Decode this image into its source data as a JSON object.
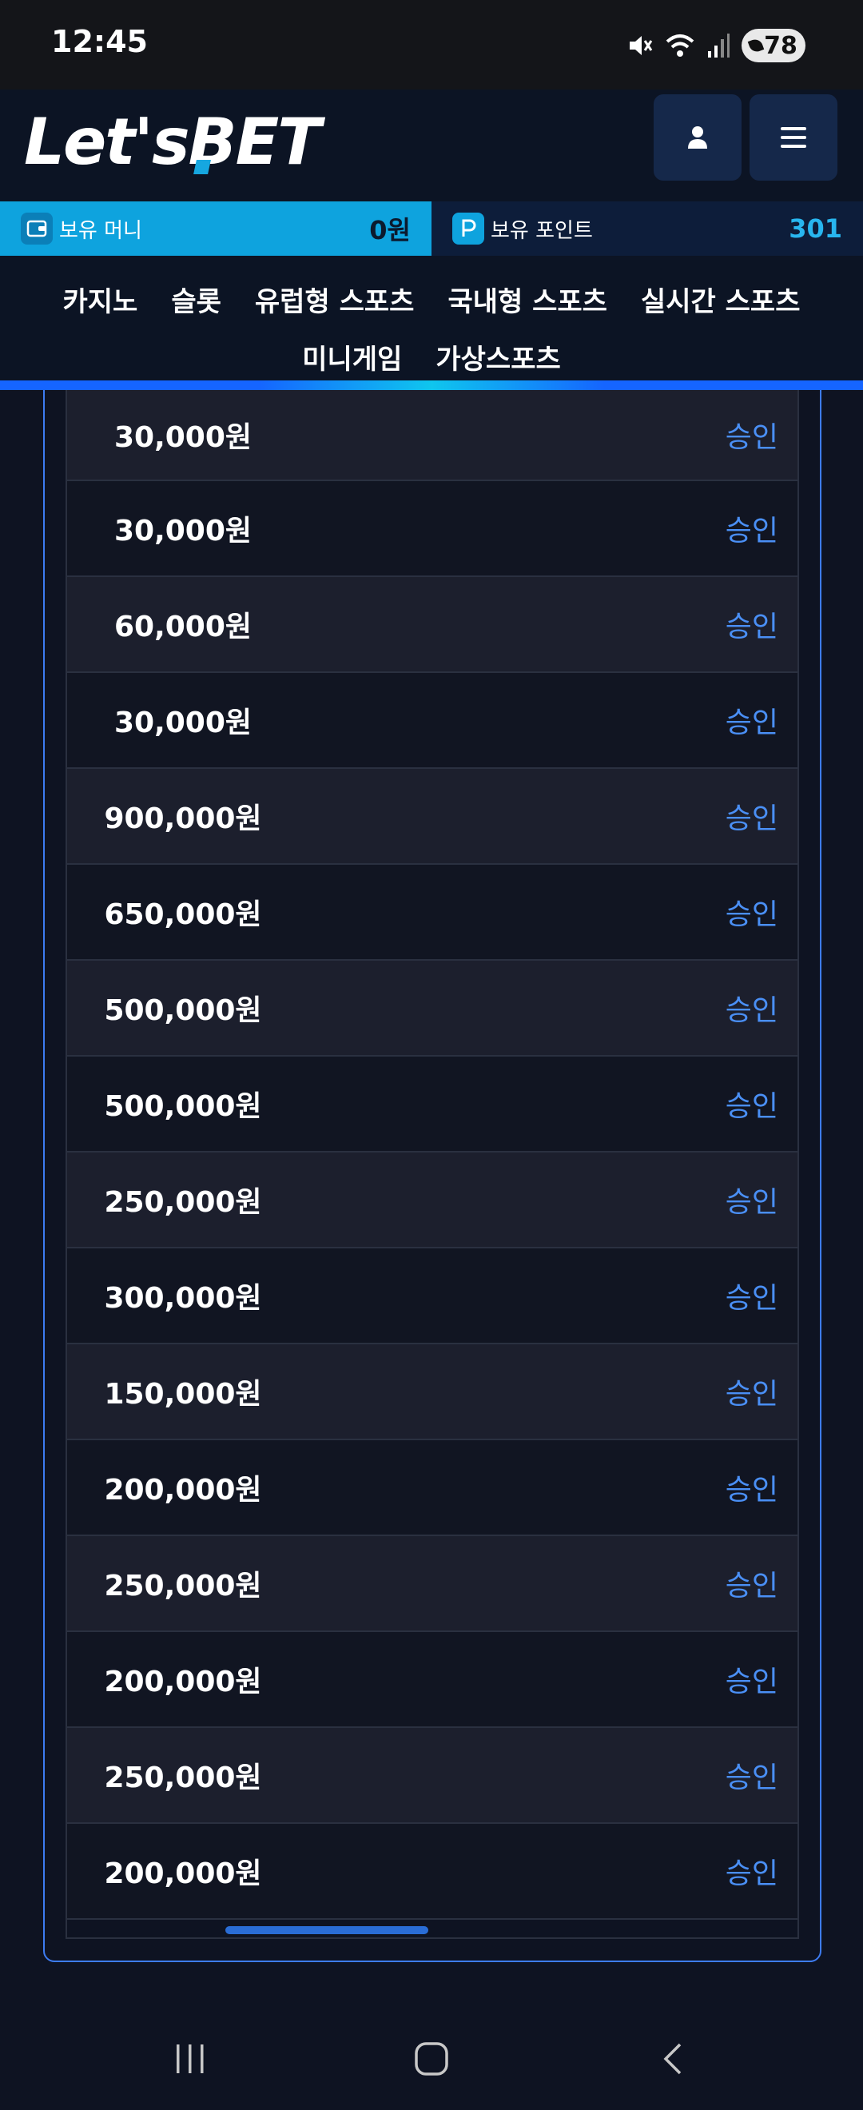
{
  "status_bar": {
    "time": "12:45",
    "battery": "78"
  },
  "header": {
    "logo_main": "Let's",
    "logo_accent": "BET",
    "user_icon": "user-icon",
    "menu_icon": "hamburger-menu-icon"
  },
  "balance": {
    "money_label": "보유 머니",
    "money_value": "0원",
    "points_label": "보유 포인트",
    "points_value": "301"
  },
  "nav": {
    "row1": [
      "카지노",
      "슬롯",
      "유럽형 스포츠",
      "국내형 스포츠",
      "실시간 스포츠"
    ],
    "row2": [
      "미니게임",
      "가상스포츠"
    ]
  },
  "rows": [
    {
      "amount": "30,000원",
      "status": "승인"
    },
    {
      "amount": "30,000원",
      "status": "승인"
    },
    {
      "amount": "60,000원",
      "status": "승인"
    },
    {
      "amount": "30,000원",
      "status": "승인"
    },
    {
      "amount": "900,000원",
      "status": "승인"
    },
    {
      "amount": "650,000원",
      "status": "승인"
    },
    {
      "amount": "500,000원",
      "status": "승인"
    },
    {
      "amount": "500,000원",
      "status": "승인"
    },
    {
      "amount": "250,000원",
      "status": "승인"
    },
    {
      "amount": "300,000원",
      "status": "승인"
    },
    {
      "amount": "150,000원",
      "status": "승인"
    },
    {
      "amount": "200,000원",
      "status": "승인"
    },
    {
      "amount": "250,000원",
      "status": "승인"
    },
    {
      "amount": "200,000원",
      "status": "승인"
    },
    {
      "amount": "250,000원",
      "status": "승인"
    },
    {
      "amount": "200,000원",
      "status": "승인"
    }
  ],
  "colors": {
    "accent_blue": "#0ea3de",
    "status_approved": "#4a8ff5",
    "panel_border": "#3d7cf2"
  }
}
